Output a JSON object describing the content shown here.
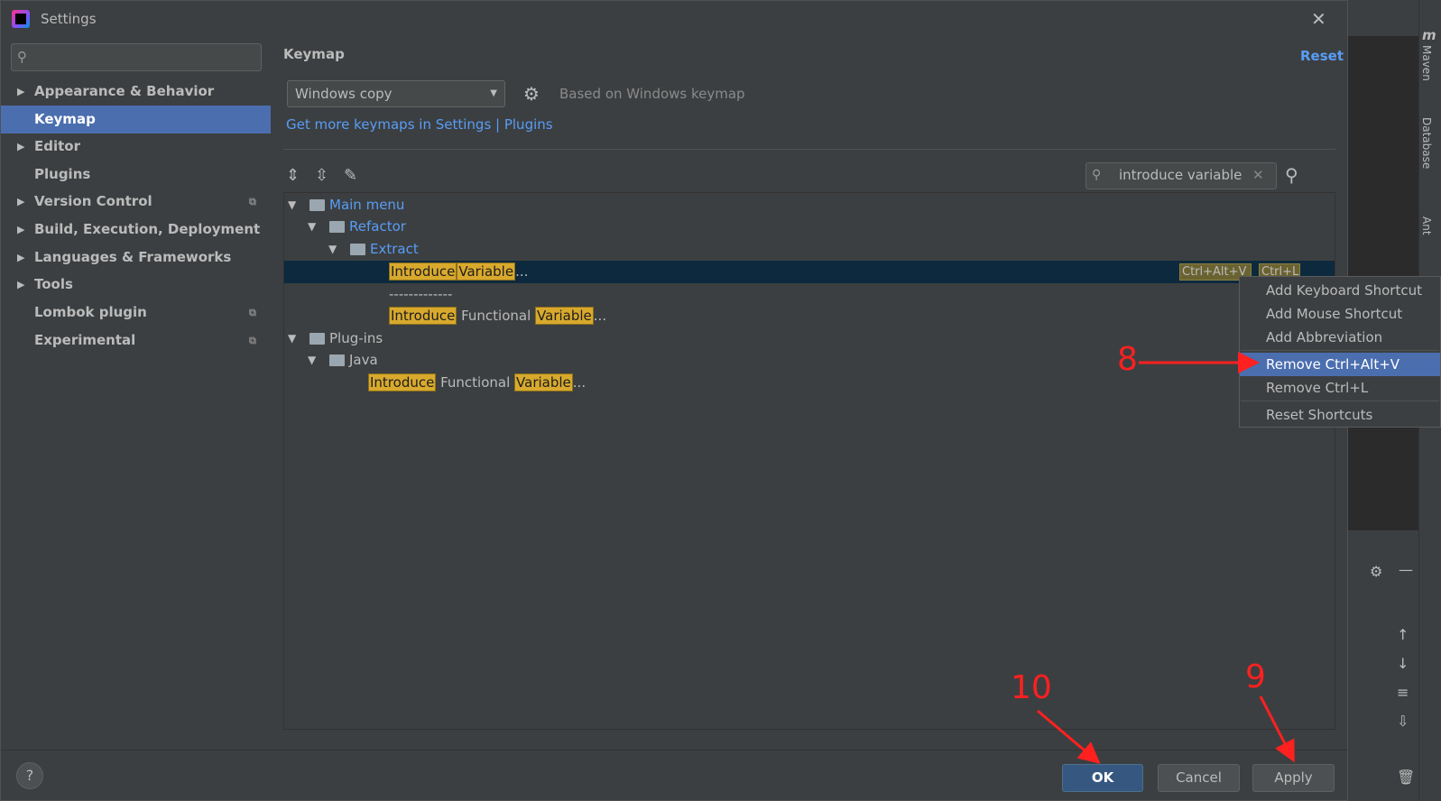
{
  "window": {
    "title": "Settings"
  },
  "sidebar": {
    "search_placeholder": "",
    "items": [
      {
        "label": "Appearance & Behavior",
        "expandable": true
      },
      {
        "label": "Keymap",
        "selected": true
      },
      {
        "label": "Editor",
        "expandable": true
      },
      {
        "label": "Plugins"
      },
      {
        "label": "Version Control",
        "expandable": true
      },
      {
        "label": "Build, Execution, Deployment",
        "expandable": true
      },
      {
        "label": "Languages & Frameworks",
        "expandable": true
      },
      {
        "label": "Tools",
        "expandable": true
      },
      {
        "label": "Lombok plugin"
      },
      {
        "label": "Experimental"
      }
    ]
  },
  "keymap": {
    "title": "Keymap",
    "reset_label": "Reset",
    "selected_keymap": "Windows copy",
    "based_on": "Based on Windows keymap",
    "get_more_link": "Get more keymaps in Settings | Plugins",
    "search_value": "introduce variable"
  },
  "tree": {
    "main_menu": "Main menu",
    "refactor": "Refactor",
    "extract": "Extract",
    "row1": {
      "w1": "Introduce",
      "w2": "Variable",
      "tail": "...",
      "shortcut1": "Ctrl+Alt+V",
      "shortcut2": "Ctrl+L"
    },
    "separator": "-------------",
    "row2": {
      "w1": "Introduce",
      "mid": " Functional ",
      "w2": "Variable",
      "tail": "..."
    },
    "plugins": "Plug-ins",
    "java": "Java",
    "row3": {
      "w1": "Introduce",
      "mid": " Functional ",
      "w2": "Variable",
      "tail": "..."
    }
  },
  "context_menu": {
    "items": [
      {
        "label": "Add Keyboard Shortcut"
      },
      {
        "label": "Add Mouse Shortcut"
      },
      {
        "label": "Add Abbreviation"
      },
      {
        "label": "Remove Ctrl+Alt+V",
        "selected": true
      },
      {
        "label": "Remove Ctrl+L"
      },
      {
        "label": "Reset Shortcuts"
      }
    ]
  },
  "buttons": {
    "ok": "OK",
    "cancel": "Cancel",
    "apply": "Apply",
    "help": "?"
  },
  "annotations": {
    "a8": "8",
    "a9": "9",
    "a10": "10"
  },
  "side_panel": {
    "tabs": [
      "Maven",
      "Database",
      "Ant"
    ]
  },
  "colors": {
    "accent": "#4b6eaf",
    "link": "#589df6",
    "highlight": "#d8a92d",
    "annotation": "#ff2020"
  }
}
